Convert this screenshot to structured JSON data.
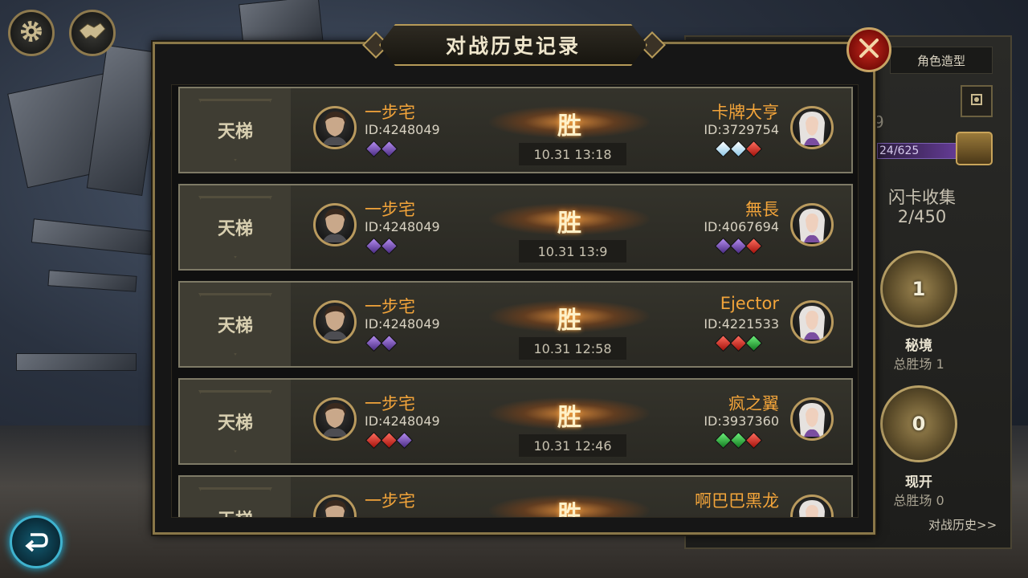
{
  "dialog": {
    "title": "对战历史记录"
  },
  "records": [
    {
      "mode": "天梯",
      "player_name": "一步宅",
      "player_id": "ID:4248049",
      "player_gems": [
        "purple",
        "purple"
      ],
      "result": "胜",
      "time": "10.31  13:18",
      "opponent_name": "卡牌大亨",
      "opponent_id": "ID:3729754",
      "opponent_gems": [
        "white",
        "white",
        "red"
      ]
    },
    {
      "mode": "天梯",
      "player_name": "一步宅",
      "player_id": "ID:4248049",
      "player_gems": [
        "purple",
        "purple"
      ],
      "result": "胜",
      "time": "10.31  13:9",
      "opponent_name": "無長",
      "opponent_id": "ID:4067694",
      "opponent_gems": [
        "purple",
        "purple",
        "red"
      ]
    },
    {
      "mode": "天梯",
      "player_name": "一步宅",
      "player_id": "ID:4248049",
      "player_gems": [
        "purple",
        "purple"
      ],
      "result": "胜",
      "time": "10.31  12:58",
      "opponent_name": "Ejector",
      "opponent_id": "ID:4221533",
      "opponent_gems": [
        "red",
        "red",
        "green"
      ]
    },
    {
      "mode": "天梯",
      "player_name": "一步宅",
      "player_id": "ID:4248049",
      "player_gems": [
        "red",
        "red",
        "purple"
      ],
      "result": "胜",
      "time": "10.31  12:46",
      "opponent_name": "疯之翼",
      "opponent_id": "ID:3937360",
      "opponent_gems": [
        "green",
        "green",
        "red"
      ]
    },
    {
      "mode": "天梯",
      "player_name": "一步宅",
      "player_id": "",
      "player_gems": [],
      "result": "胜",
      "time": "",
      "opponent_name": "啊巴巴黑龙",
      "opponent_id": "",
      "opponent_gems": []
    }
  ],
  "right_panel": {
    "tab_label": "角色造型",
    "partial_number": "9",
    "progress_text": "24/625",
    "progress_fraction": 0.038,
    "flash_card_label": "闪卡收集",
    "flash_card_count": "2/450",
    "secret_realm": {
      "count": "1",
      "title": "秘境",
      "wins": "总胜场 1"
    },
    "reveal": {
      "count": "0",
      "title": "现开",
      "wins": "总胜场 0"
    },
    "history_link": "对战历史>>"
  },
  "icons": {
    "settings": "gear-icon",
    "handshake": "handshake-icon",
    "close": "close-icon",
    "back": "back-arrow-icon"
  },
  "colors": {
    "name_orange": "#f2a43a",
    "frame_gold": "#8a7748",
    "gem_purple": "#7a4fc0",
    "gem_red": "#d8261c",
    "gem_green": "#27b83a",
    "gem_white": "#cfe8f6"
  }
}
